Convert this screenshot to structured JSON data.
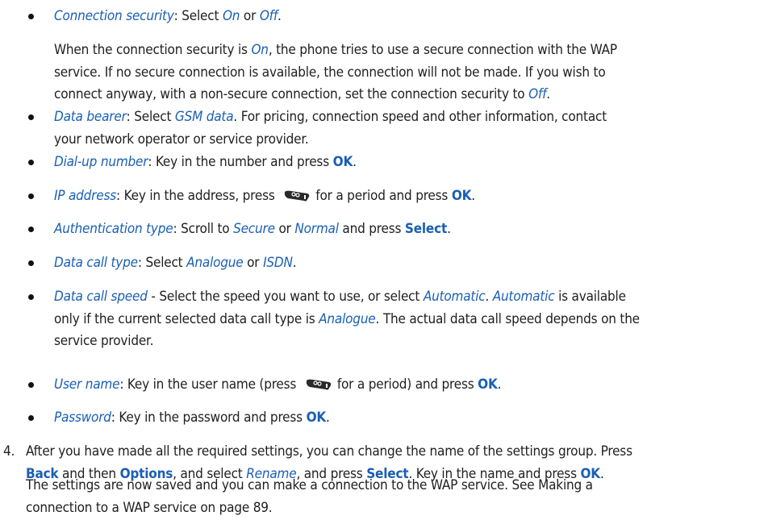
{
  "bullets": [
    {
      "lines": [
        [
          [
            "opt",
            "Connection security"
          ],
          [
            "t",
            ": Select "
          ],
          [
            "opt",
            "On"
          ],
          [
            "t",
            " or "
          ],
          [
            "opt",
            "Off"
          ],
          [
            "t",
            "."
          ]
        ]
      ]
    },
    {
      "para": [
        [
          [
            "t",
            "When the connection security is "
          ],
          [
            "opt",
            "On"
          ],
          [
            "t",
            ", the phone tries to use a secure connection with the WAP"
          ]
        ],
        [
          [
            "t",
            "service. If no secure connection is available, the connection will not be made. If you wish to"
          ]
        ],
        [
          [
            "t",
            "connect anyway, with a non-secure connection, set the connection security to "
          ],
          [
            "opt",
            "Off"
          ],
          [
            "t",
            "."
          ]
        ]
      ]
    },
    {
      "lines": [
        [
          [
            "opt",
            "Data bearer"
          ],
          [
            "t",
            ": Select "
          ],
          [
            "opt",
            "GSM data"
          ],
          [
            "t",
            ". For pricing, connection speed and other information, contact"
          ]
        ],
        [
          [
            "t",
            "your network operator or service provider."
          ]
        ]
      ]
    },
    {
      "lines": [
        [
          [
            "opt",
            "Dial-up number"
          ],
          [
            "t",
            ": Key in the number and press "
          ],
          [
            "key",
            "OK"
          ],
          [
            "t",
            "."
          ]
        ]
      ]
    },
    {
      "lines": [
        [
          [
            "opt",
            "IP address"
          ],
          [
            "t",
            ": Key in the address, press "
          ],
          [
            "icon",
            "key-0-icon"
          ],
          [
            "t",
            "for a period and press "
          ],
          [
            "key",
            "OK"
          ],
          [
            "t",
            "."
          ]
        ]
      ]
    },
    {
      "lines": [
        [
          [
            "opt",
            "Authentication type"
          ],
          [
            "t",
            ": Scroll to "
          ],
          [
            "opt",
            "Secure"
          ],
          [
            "t",
            " or "
          ],
          [
            "opt",
            "Normal"
          ],
          [
            "t",
            " and press "
          ],
          [
            "key",
            "Select"
          ],
          [
            "t",
            "."
          ]
        ]
      ]
    },
    {
      "lines": [
        [
          [
            "opt",
            "Data call type"
          ],
          [
            "t",
            ": Select "
          ],
          [
            "opt",
            "Analogue"
          ],
          [
            "t",
            " or "
          ],
          [
            "opt",
            "ISDN"
          ],
          [
            "t",
            "."
          ]
        ]
      ]
    },
    {
      "lines": [
        [
          [
            "opt",
            "Data call speed"
          ],
          [
            "t",
            " - Select the speed you want to use, or select "
          ],
          [
            "opt",
            "Automatic"
          ],
          [
            "t",
            ". "
          ],
          [
            "opt",
            "Automatic"
          ],
          [
            "t",
            " is available"
          ]
        ],
        [
          [
            "t",
            "only if the current selected data call type is "
          ],
          [
            "opt",
            "Analogue"
          ],
          [
            "t",
            ". The actual data call speed depends on the"
          ]
        ],
        [
          [
            "t",
            "service provider."
          ]
        ]
      ]
    },
    {
      "lines": [
        [
          [
            "opt",
            "User name"
          ],
          [
            "t",
            ": Key in the user name (press "
          ],
          [
            "icon",
            "key-0-icon"
          ],
          [
            "t",
            "for a period) and press "
          ],
          [
            "key",
            "OK"
          ],
          [
            "t",
            "."
          ]
        ]
      ]
    },
    {
      "lines": [
        [
          [
            "opt",
            "Password"
          ],
          [
            "t",
            ": Key in the password and press "
          ],
          [
            "key",
            "OK"
          ],
          [
            "t",
            "."
          ]
        ]
      ]
    }
  ],
  "step4": {
    "number": "4.",
    "lines": [
      [
        [
          "t",
          "After you have made all the required settings, you can change the name of the settings group. Press"
        ]
      ],
      [
        [
          "key",
          "Back"
        ],
        [
          "t",
          " and then "
        ],
        [
          "key",
          "Options"
        ],
        [
          "t",
          ", and select "
        ],
        [
          "opt",
          "Rename"
        ],
        [
          "t",
          ", and press "
        ],
        [
          "key",
          "Select"
        ],
        [
          "t",
          ". Key in the name and press "
        ],
        [
          "key",
          "OK"
        ],
        [
          "t",
          "."
        ]
      ]
    ],
    "after": [
      [
        [
          "t",
          "The settings are now saved and you can make a connection to the WAP service. See Making a"
        ]
      ],
      [
        [
          "t",
          "connection to a WAP service on page 89."
        ]
      ]
    ]
  }
}
